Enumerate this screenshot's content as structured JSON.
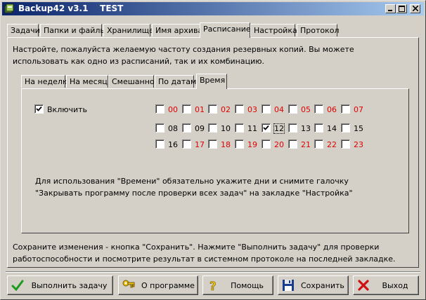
{
  "window": {
    "title": "Backup42 v3.1    TEST",
    "minimize_glyph": "_",
    "maximize_glyph": "□",
    "close_glyph": "×"
  },
  "main_tabs": [
    {
      "label": "Задачи",
      "active": false
    },
    {
      "label": "Папки и файлы",
      "active": false
    },
    {
      "label": "Хранилище",
      "active": false
    },
    {
      "label": "Имя архива",
      "active": false
    },
    {
      "label": "Расписание",
      "active": true
    },
    {
      "label": "Настройка",
      "active": false
    },
    {
      "label": "Протокол",
      "active": false
    }
  ],
  "schedule": {
    "intro_line1": "Настройте, пожалуйста желаемую частоту создания резервных копий. Вы можете",
    "intro_line2": "использовать как одно из расписаний, так и их комбинацию.",
    "tabs": [
      {
        "label": "На неделю",
        "active": false
      },
      {
        "label": "На месяц",
        "active": false
      },
      {
        "label": "Смешанное",
        "active": false
      },
      {
        "label": "По датам",
        "active": false
      },
      {
        "label": "Время",
        "active": true
      }
    ],
    "time": {
      "enable_label": "Включить",
      "enable_checked": true,
      "hours": [
        {
          "label": "00",
          "checked": false,
          "red": true
        },
        {
          "label": "01",
          "checked": false,
          "red": true
        },
        {
          "label": "02",
          "checked": false,
          "red": true
        },
        {
          "label": "03",
          "checked": false,
          "red": true
        },
        {
          "label": "04",
          "checked": false,
          "red": true
        },
        {
          "label": "05",
          "checked": false,
          "red": true
        },
        {
          "label": "06",
          "checked": false,
          "red": true
        },
        {
          "label": "07",
          "checked": false,
          "red": true
        },
        {
          "label": "08",
          "checked": false,
          "red": false
        },
        {
          "label": "09",
          "checked": false,
          "red": false
        },
        {
          "label": "10",
          "checked": false,
          "red": false
        },
        {
          "label": "11",
          "checked": false,
          "red": false
        },
        {
          "label": "12",
          "checked": true,
          "red": false,
          "focused": true
        },
        {
          "label": "13",
          "checked": false,
          "red": false
        },
        {
          "label": "14",
          "checked": false,
          "red": false
        },
        {
          "label": "15",
          "checked": false,
          "red": false
        },
        {
          "label": "16",
          "checked": false,
          "red": false
        },
        {
          "label": "17",
          "checked": false,
          "red": true
        },
        {
          "label": "18",
          "checked": false,
          "red": true
        },
        {
          "label": "19",
          "checked": false,
          "red": true
        },
        {
          "label": "20",
          "checked": false,
          "red": true
        },
        {
          "label": "21",
          "checked": false,
          "red": true
        },
        {
          "label": "22",
          "checked": false,
          "red": true
        },
        {
          "label": "23",
          "checked": false,
          "red": true
        }
      ],
      "note_line1": "Для использования \"Времени\" обязательно укажите дни и снимите галочку",
      "note_line2": "\"Закрывать программу после проверки всех задач\" на закладке \"Настройка\""
    },
    "footer_line1": "Сохраните изменения - кнопка \"Сохранить\". Нажмите \"Выполнить задачу\" для проверки",
    "footer_line2": "работоспособности и посмотрите результат в системном протоколе на последней закладке."
  },
  "buttons": {
    "run": {
      "label": "Выполнить задачу",
      "icon": "checkmark-icon"
    },
    "about": {
      "label": "О программе",
      "icon": "key-icon"
    },
    "help": {
      "label": "Помощь",
      "icon": "question-icon"
    },
    "save": {
      "label": "Сохранить",
      "icon": "floppy-icon"
    },
    "exit": {
      "label": "Выход",
      "icon": "x-icon"
    }
  },
  "colors": {
    "title_start": "#0a246a",
    "title_end": "#a6caf0",
    "red_hour": "#e00000",
    "face": "#d4d0c8"
  }
}
